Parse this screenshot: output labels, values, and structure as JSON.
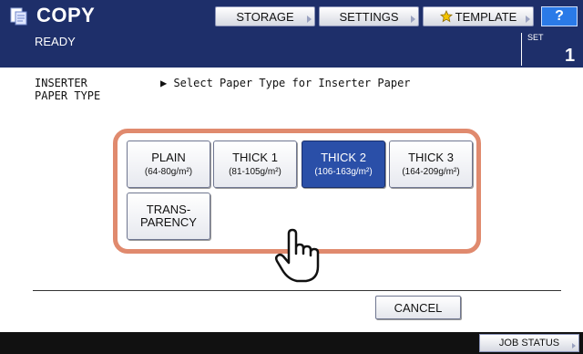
{
  "header": {
    "app_title": "COPY",
    "buttons": {
      "storage": "STORAGE",
      "settings": "SETTINGS",
      "template": "TEMPLATE",
      "help": "?"
    },
    "status": "READY",
    "set_label": "SET",
    "set_value": "1"
  },
  "main": {
    "section_label_line1": "INSERTER",
    "section_label_line2": "PAPER TYPE",
    "instruction": "▶ Select Paper Type for Inserter Paper",
    "paper_types": [
      {
        "name": "PLAIN",
        "weight": "(64-80g/m²)",
        "selected": false
      },
      {
        "name": "THICK 1",
        "weight": "(81-105g/m²)",
        "selected": false
      },
      {
        "name": "THICK 2",
        "weight": "(106-163g/m²)",
        "selected": true
      },
      {
        "name": "THICK 3",
        "weight": "(164-209g/m²)",
        "selected": false
      },
      {
        "name_line1": "TRANS-",
        "name_line2": "PARENCY",
        "selected": false
      }
    ],
    "cancel_label": "CANCEL"
  },
  "footer": {
    "job_status": "JOB STATUS"
  },
  "colors": {
    "header_bg": "#1e2f6a",
    "selected_bg": "#2a4fa8",
    "highlight_border": "#e08a6e",
    "help_bg": "#2a7ae8"
  },
  "icons": {
    "app": "copy-icon",
    "template": "star-icon",
    "pointer": "hand-pointer-icon"
  }
}
